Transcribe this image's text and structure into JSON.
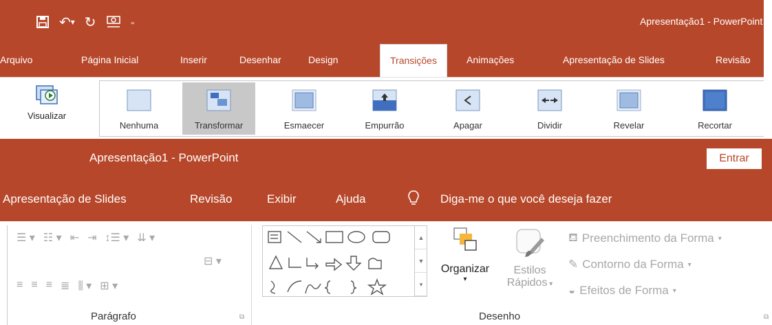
{
  "top": {
    "quick_access": {
      "save_icon": "save-icon",
      "undo_icon": "undo-icon",
      "redo_icon": "redo-icon",
      "present_icon": "present-from-start-icon",
      "customize_icon": "customize-qat-icon"
    },
    "window_title": "Apresentação1  -  PowerPoint",
    "tabs": [
      {
        "label": "Arquivo"
      },
      {
        "label": "Página Inicial"
      },
      {
        "label": "Inserir"
      },
      {
        "label": "Desenhar"
      },
      {
        "label": "Design"
      },
      {
        "label": "Transições",
        "active": true
      },
      {
        "label": "Animações"
      },
      {
        "label": "Apresentação de Slides"
      },
      {
        "label": "Revisão"
      }
    ],
    "preview_button": "Visualizar",
    "transitions": [
      {
        "label": "Nenhuma"
      },
      {
        "label": "Transformar",
        "selected": true
      },
      {
        "label": "Esmaecer"
      },
      {
        "label": "Empurrão"
      },
      {
        "label": "Apagar"
      },
      {
        "label": "Dividir"
      },
      {
        "label": "Revelar"
      },
      {
        "label": "Recortar"
      }
    ]
  },
  "bottom": {
    "window_title": "Apresentação1  -  PowerPoint",
    "sign_in_button": "Entrar",
    "tabs": [
      {
        "label": "Apresentação de Slides"
      },
      {
        "label": "Revisão"
      },
      {
        "label": "Exibir"
      },
      {
        "label": "Ajuda"
      }
    ],
    "tell_me": "Diga-me o que você deseja fazer",
    "groups": {
      "paragraph_label": "Parágrafo",
      "drawing_label": "Desenho",
      "arrange_button": "Organizar",
      "quick_styles_line1": "Estilos",
      "quick_styles_line2": "Rápidos",
      "shape_fill": "Preenchimento da Forma",
      "shape_outline": "Contorno da Forma",
      "shape_effects": "Efeitos de Forma"
    }
  },
  "colors": {
    "accent": "#b7472a",
    "ribbon_bg": "#ffffff",
    "selected_bg": "#c8c8c8"
  }
}
